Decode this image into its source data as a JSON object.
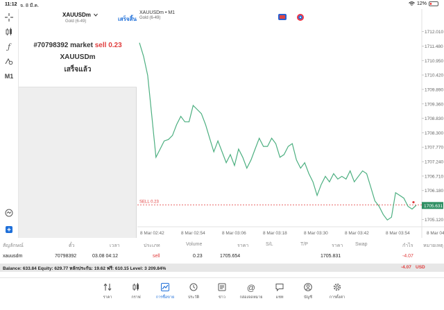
{
  "status_bar": {
    "time": "11:12",
    "date": " จ. 8 มี.ค.",
    "battery": "12%"
  },
  "toolbar": {
    "crosshair_icon": "crosshair-icon",
    "indicators_icon": "indicators-icon",
    "function_label": "ƒ",
    "objects_icon": "objects-icon",
    "timeframe": "M1",
    "zoom_icon": "zoom-icon",
    "add_icon": "add-icon"
  },
  "order_panel": {
    "symbol": "XAUUSDm",
    "description": "Gold (6-49)",
    "done_label": "เสร็จสิ้น",
    "order_id": "#70798392 market",
    "order_side": "sell",
    "order_volume": "0.23",
    "order_symbol": "XAUUSDm",
    "order_status": "เสร็จแล้ว"
  },
  "chart_header": {
    "symbol": "XAUUSDm • M1",
    "description": "Gold (6-49)"
  },
  "chart_data": {
    "type": "line",
    "symbol": "XAUUSDm",
    "timeframe": "M1",
    "ylim": [
      1704.85,
      1712.28
    ],
    "y_ticks": [
      "1712.010",
      "1711.480",
      "1710.950",
      "1710.420",
      "1709.890",
      "1709.360",
      "1708.830",
      "1708.300",
      "1707.770",
      "1707.240",
      "1706.710",
      "1706.180",
      "1705.650",
      "1705.120"
    ],
    "x_ticks": [
      "8 Mar 02:42",
      "8 Mar 02:54",
      "8 Mar 03:06",
      "8 Mar 03:18",
      "8 Mar 03:30",
      "8 Mar 03:42",
      "8 Mar 03:54",
      "8 Mar 04:06"
    ],
    "values": [
      1711.6,
      1711.1,
      1710.4,
      1708.9,
      1707.4,
      1707.7,
      1708.0,
      1708.05,
      1708.2,
      1708.6,
      1708.9,
      1708.7,
      1708.7,
      1709.3,
      1709.15,
      1709.0,
      1708.6,
      1708.1,
      1707.6,
      1708.0,
      1707.6,
      1707.2,
      1707.5,
      1707.1,
      1707.7,
      1707.4,
      1707.0,
      1707.3,
      1707.7,
      1708.1,
      1707.8,
      1707.8,
      1708.1,
      1707.9,
      1707.4,
      1707.5,
      1707.8,
      1707.9,
      1707.3,
      1707.0,
      1707.2,
      1706.8,
      1706.5,
      1706.0,
      1706.4,
      1706.7,
      1706.5,
      1706.8,
      1706.6,
      1706.7,
      1706.6,
      1706.9,
      1706.5,
      1706.7,
      1706.9,
      1706.8,
      1706.3,
      1705.8,
      1705.6,
      1705.3,
      1705.1,
      1705.2,
      1706.1,
      1706.0,
      1705.9,
      1705.6,
      1705.5,
      1705.64
    ],
    "current_price": "1705.631",
    "order_line": {
      "label": "SELL 0.23",
      "price": 1705.654
    },
    "colors": {
      "line": "#4caf80",
      "order_line": "#e03c3c",
      "price_label_bg": "#2f8f63"
    }
  },
  "table": {
    "headers": [
      "สัญลักษณ์",
      "ตั๋ว",
      "เวลา",
      "ประเภท",
      "Volume",
      "ราคา",
      "S/L",
      "T/P",
      "ราคา",
      "Swap",
      "กำไร",
      "หมายเหตุ"
    ],
    "row": {
      "symbol": "xauusdm",
      "ticket": "70798392",
      "time": "03.08 04:12",
      "type": "sell",
      "volume": "0.23",
      "open_price": "1705.654",
      "current_price": "1705.831",
      "profit": "-4.07"
    },
    "balance_line": "Balance: 633.84 Equity: 629.77 หลักประกัน: 19.62 ฟรี: 610.15 Level: 3 209.84%",
    "balance_profit": "-4.07",
    "currency": "USD"
  },
  "tabs": [
    {
      "label": "ราคา",
      "icon": "quotes-icon"
    },
    {
      "label": "กราฟ",
      "icon": "chart-icon"
    },
    {
      "label": "การซื้อขาย",
      "icon": "trade-icon",
      "active": true
    },
    {
      "label": "ประวัติ",
      "icon": "history-icon"
    },
    {
      "label": "ข่าว",
      "icon": "news-icon"
    },
    {
      "label": "กล่องจดหมาย",
      "icon": "mailbox-icon"
    },
    {
      "label": "แชท",
      "icon": "chat-icon"
    },
    {
      "label": "บัญชี",
      "icon": "account-icon"
    },
    {
      "label": "การตั้งค่า",
      "icon": "settings-icon"
    }
  ]
}
